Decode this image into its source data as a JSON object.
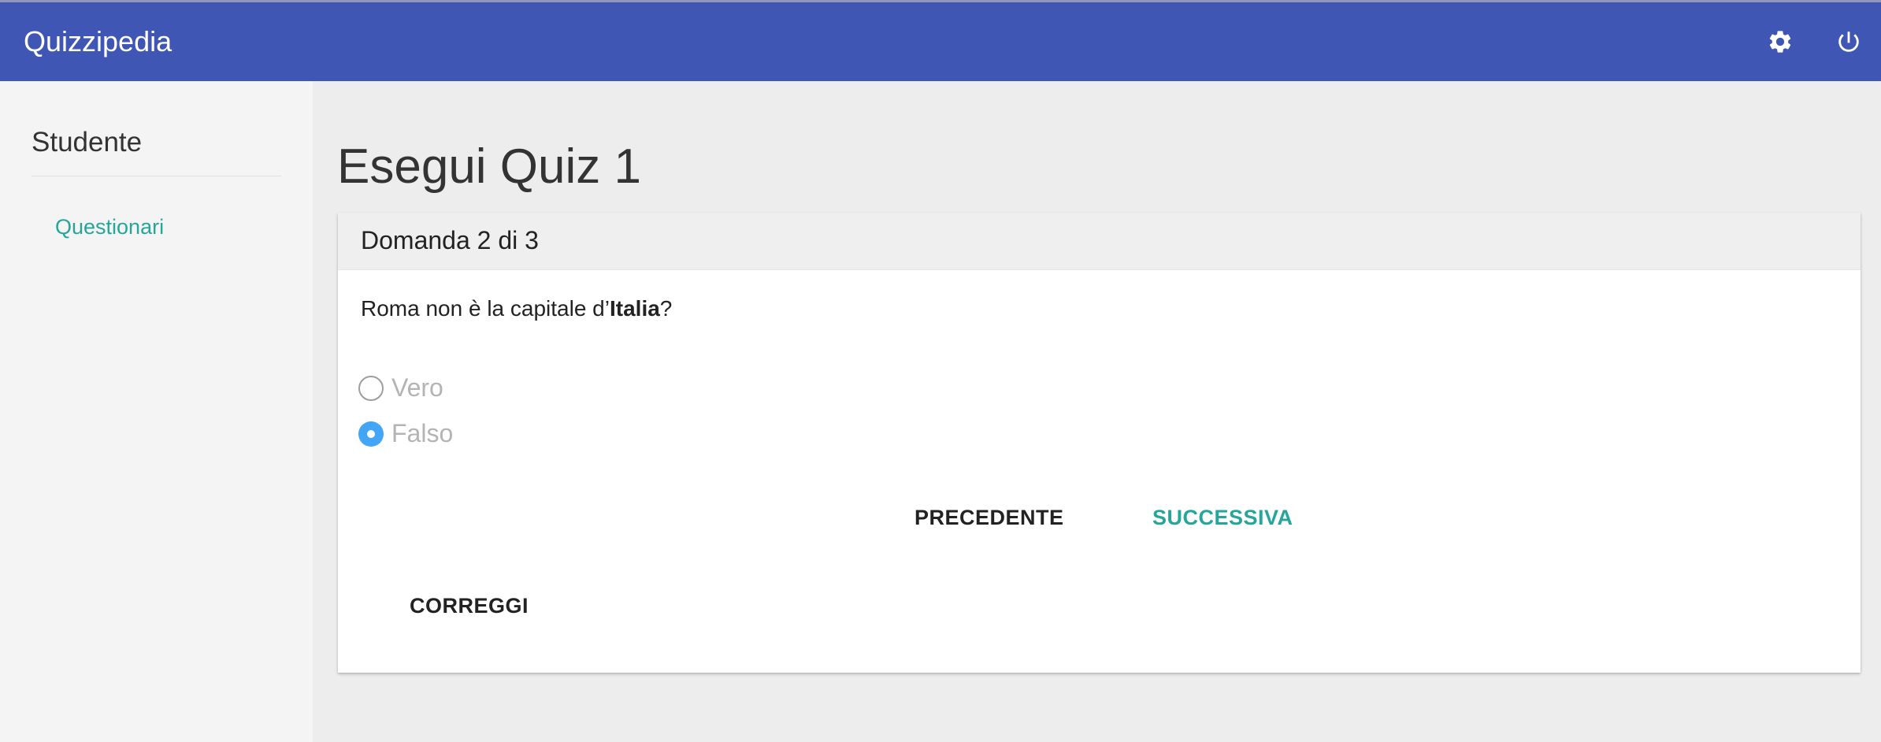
{
  "app": {
    "title": "Quizzipedia",
    "brand_color": "#3f56b5",
    "icons": {
      "settings": "gear-icon",
      "logout": "power-icon"
    }
  },
  "sidebar": {
    "heading": "Studente",
    "items": [
      {
        "label": "Questionari",
        "color": "#26a69a"
      }
    ]
  },
  "main": {
    "page_title": "Esegui Quiz 1",
    "card": {
      "header": "Domanda 2 di 3",
      "question": {
        "prefix": "Roma non è la capitale d’",
        "emphasis": "Italia",
        "suffix": "?"
      },
      "options": [
        {
          "label": "Vero",
          "checked": false
        },
        {
          "label": "Falso",
          "checked": true
        }
      ],
      "selected_color": "#42a5f5",
      "buttons": {
        "previous": "PRECEDENTE",
        "next": "SUCCESSIVA",
        "correct": "CORREGGI"
      }
    }
  }
}
